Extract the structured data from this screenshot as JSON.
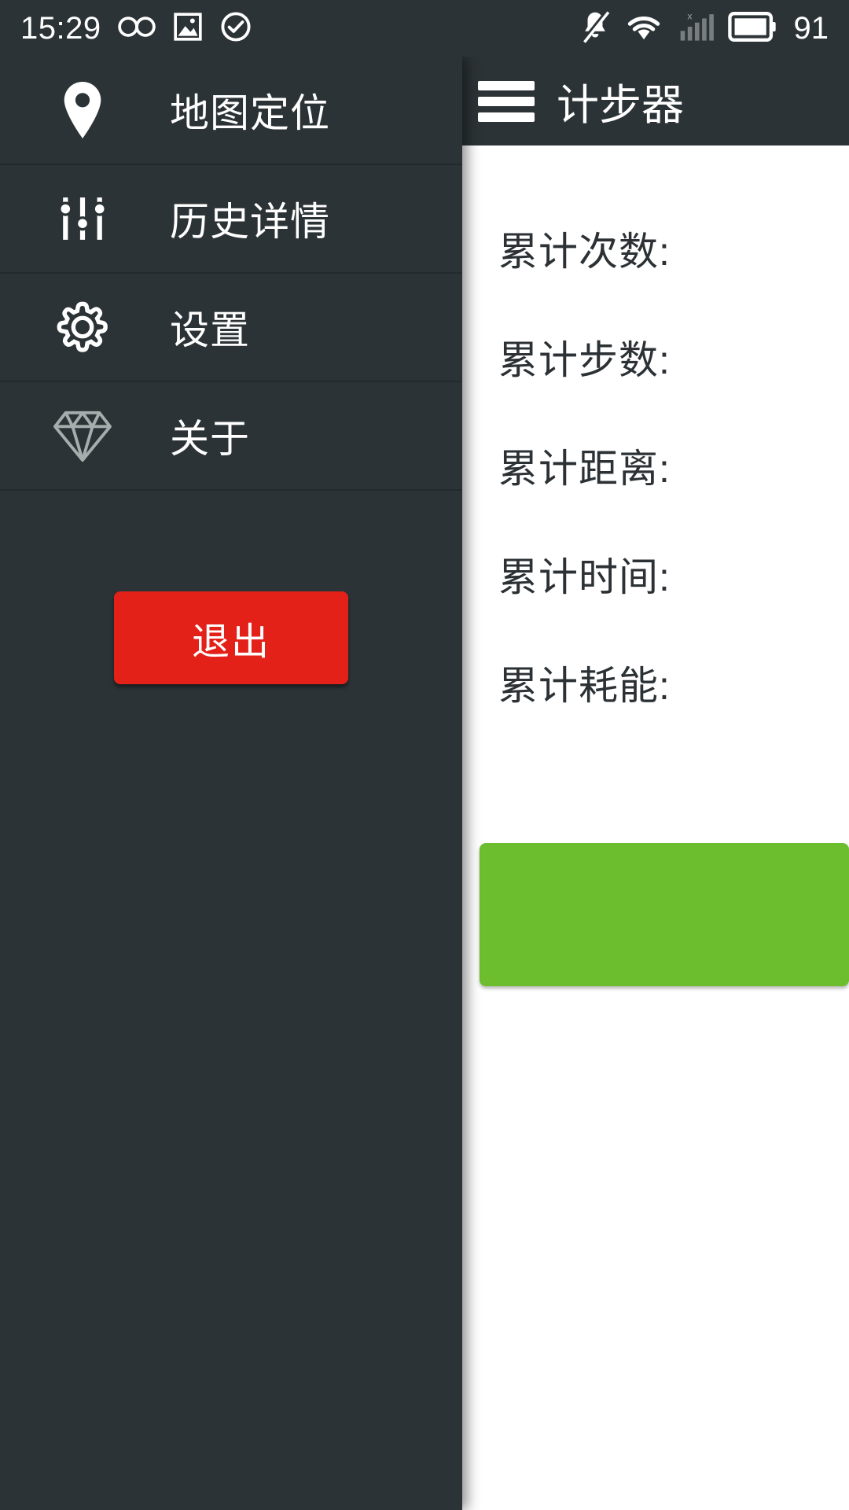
{
  "status_bar": {
    "clock": "15:29",
    "battery_level": "91",
    "left_icons": [
      "infinity-icon",
      "image-icon",
      "check-circle-icon"
    ],
    "right_icons": [
      "mute-bell-icon",
      "wifi-icon",
      "signal-bars-no-sim-icon",
      "battery-icon"
    ]
  },
  "app_bar": {
    "title": "计步器",
    "menu_icon": "hamburger-menu-icon"
  },
  "stats": {
    "rows": [
      {
        "label": "累计次数:",
        "value": ""
      },
      {
        "label": "累计步数:",
        "value": ""
      },
      {
        "label": "累计距离:",
        "value": ""
      },
      {
        "label": "累计时间:",
        "value": ""
      },
      {
        "label": "累计耗能:",
        "value": ""
      }
    ],
    "action_button_label": ""
  },
  "drawer": {
    "items": [
      {
        "label": "地图定位",
        "icon": "map-pin-icon"
      },
      {
        "label": "历史详情",
        "icon": "sliders-icon"
      },
      {
        "label": "设置",
        "icon": "gear-icon"
      },
      {
        "label": "关于",
        "icon": "diamond-icon"
      }
    ],
    "exit_label": "退出"
  },
  "colors": {
    "drawer_background": "#2C3336",
    "app_bar_background": "#2C3336",
    "content_background": "#FFFFFF",
    "exit_button": "#E32119",
    "action_button": "#6CBE2E",
    "text_primary": "#FFFFFF",
    "text_on_content": "#2B3134",
    "divider": "#232A2D"
  }
}
